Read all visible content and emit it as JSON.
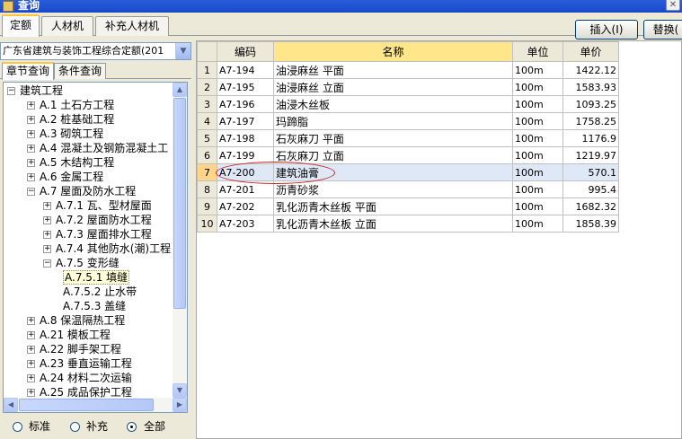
{
  "window": {
    "title": "查询"
  },
  "top_tabs": [
    "定额",
    "人材机",
    "补充人材机"
  ],
  "toolbar": {
    "insert_label": "插入(I)",
    "replace_label": "替换("
  },
  "left": {
    "combo_value": "广东省建筑与装饰工程综合定额(201",
    "subtabs": [
      "章节查询",
      "条件查询"
    ],
    "tree": [
      {
        "label": "建筑工程",
        "expander": "−"
      },
      {
        "label": "A.1 土石方工程",
        "expander": "+"
      },
      {
        "label": "A.2 桩基础工程",
        "expander": "+"
      },
      {
        "label": "A.3 砌筑工程",
        "expander": "+"
      },
      {
        "label": "A.4 混凝土及钢筋混凝土工",
        "expander": "+"
      },
      {
        "label": "A.5 木结构工程",
        "expander": "+"
      },
      {
        "label": "A.6 金属工程",
        "expander": "+"
      },
      {
        "label": "A.7 屋面及防水工程",
        "expander": "−"
      },
      {
        "label": "A.7.1 瓦、型材屋面",
        "expander": "+"
      },
      {
        "label": "A.7.2 屋面防水工程",
        "expander": "+"
      },
      {
        "label": "A.7.3 屋面排水工程",
        "expander": "+"
      },
      {
        "label": "A.7.4 其他防水(潮)工程",
        "expander": "+"
      },
      {
        "label": "A.7.5 变形缝",
        "expander": "−"
      },
      {
        "label": "A.7.5.1 填缝",
        "expander": ""
      },
      {
        "label": "A.7.5.2 止水带",
        "expander": ""
      },
      {
        "label": "A.7.5.3 盖缝",
        "expander": ""
      },
      {
        "label": "A.8 保温隔热工程",
        "expander": "+"
      },
      {
        "label": "A.21 模板工程",
        "expander": "+"
      },
      {
        "label": "A.22 脚手架工程",
        "expander": "+"
      },
      {
        "label": "A.23 垂直运输工程",
        "expander": "+"
      },
      {
        "label": "A.24 材料二次运输",
        "expander": "+"
      },
      {
        "label": "A.25 成品保护工程",
        "expander": "+"
      }
    ],
    "radios": [
      {
        "label": "标准",
        "checked": false
      },
      {
        "label": "补充",
        "checked": false
      },
      {
        "label": "全部",
        "checked": true
      }
    ]
  },
  "grid": {
    "headers": [
      "编码",
      "名称",
      "单位",
      "单价"
    ],
    "rows": [
      {
        "num": "1",
        "code": "A7-194",
        "name": "油浸麻丝 平面",
        "unit": "100m",
        "price": "1422.12"
      },
      {
        "num": "2",
        "code": "A7-195",
        "name": "油浸麻丝 立面",
        "unit": "100m",
        "price": "1583.93"
      },
      {
        "num": "3",
        "code": "A7-196",
        "name": "油浸木丝板",
        "unit": "100m",
        "price": "1093.25"
      },
      {
        "num": "4",
        "code": "A7-197",
        "name": "玛蹄脂",
        "unit": "100m",
        "price": "1758.25"
      },
      {
        "num": "5",
        "code": "A7-198",
        "name": "石灰麻刀 平面",
        "unit": "100m",
        "price": "1176.9"
      },
      {
        "num": "6",
        "code": "A7-199",
        "name": "石灰麻刀 立面",
        "unit": "100m",
        "price": "1219.97"
      },
      {
        "num": "7",
        "code": "A7-200",
        "name": "建筑油膏",
        "unit": "100m",
        "price": "570.1"
      },
      {
        "num": "8",
        "code": "A7-201",
        "name": "沥青砂浆",
        "unit": "100m",
        "price": "995.4"
      },
      {
        "num": "9",
        "code": "A7-202",
        "name": "乳化沥青木丝板 平面",
        "unit": "100m",
        "price": "1682.32"
      },
      {
        "num": "10",
        "code": "A7-203",
        "name": "乳化沥青木丝板 立面",
        "unit": "100m",
        "price": "1858.39"
      }
    ],
    "selected_row": "7"
  }
}
